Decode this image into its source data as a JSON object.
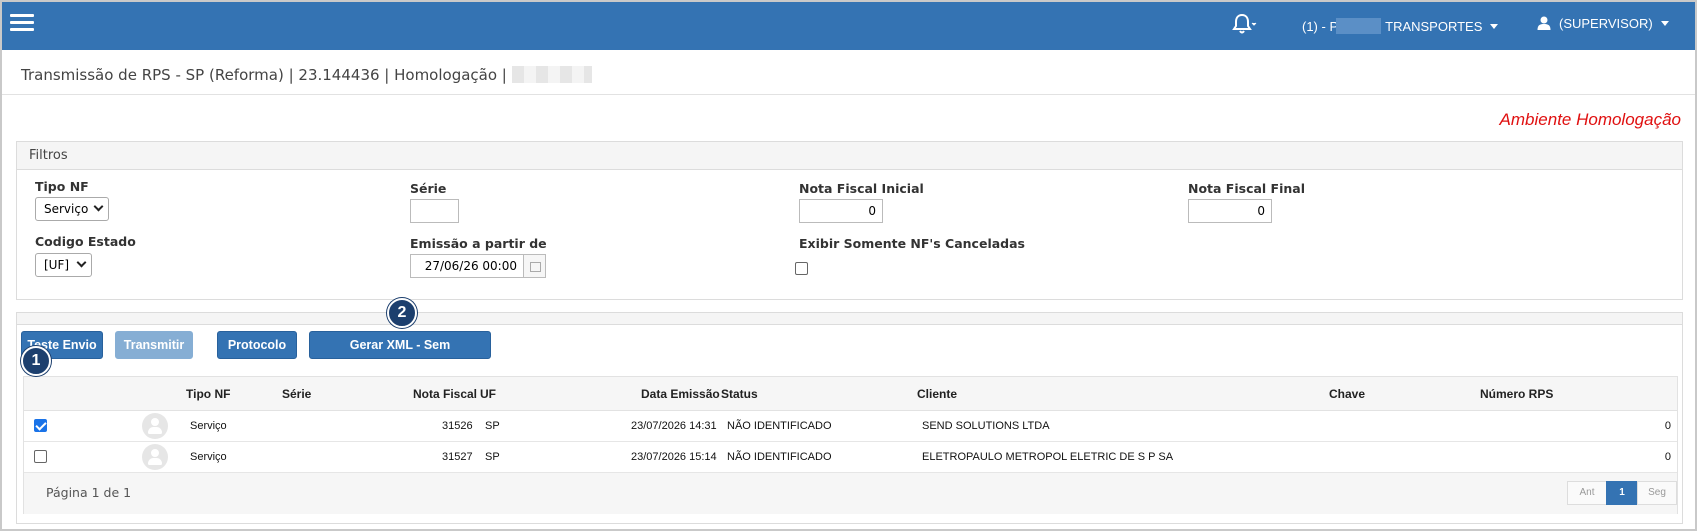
{
  "header": {
    "company": "(1) - P",
    "company_suffix": "TRANSPORTES",
    "user": "(SUPERVISOR)"
  },
  "page": {
    "title": "Transmissão de RPS - SP (Reforma) | 23.144436 | Homologação |",
    "ambiente": "Ambiente Homologação"
  },
  "filters": {
    "panel_title": "Filtros",
    "tipo_nf_label": "Tipo NF",
    "tipo_nf_value": "Serviço",
    "serie_label": "Série",
    "serie_value": "",
    "nf_inicial_label": "Nota Fiscal Inicial",
    "nf_inicial_value": "0",
    "nf_final_label": "Nota Fiscal Final",
    "nf_final_value": "0",
    "codigo_estado_label": "Codigo Estado",
    "codigo_estado_value": "[UF]",
    "emissao_label": "Emissão a partir de",
    "emissao_value": "27/06/26 00:00",
    "canceladas_label": "Exibir Somente NF's Canceladas",
    "canceladas_checked": false
  },
  "actions": {
    "teste_envio": "Teste Envio",
    "transmitir": "Transmitir",
    "protocolo": "Protocolo",
    "gerar_xml": "Gerar XML - Sem Transmissão",
    "badge_1": "1",
    "badge_2": "2"
  },
  "table": {
    "columns": {
      "tipo_nf": "Tipo NF",
      "serie": "Série",
      "nota_fiscal": "Nota Fiscal",
      "uf": "UF",
      "data_emissao": "Data Emissão",
      "status": "Status",
      "cliente": "Cliente",
      "chave": "Chave",
      "numero_rps": "Número RPS"
    },
    "rows": [
      {
        "checked": true,
        "tipo_nf": "Serviço",
        "serie": "",
        "nota_fiscal": "31526",
        "uf": "SP",
        "data_emissao": "23/07/2026 14:31",
        "status": "NÃO IDENTIFICADO",
        "cliente": "SEND SOLUTIONS LTDA",
        "chave": "",
        "numero_rps": "0"
      },
      {
        "checked": false,
        "tipo_nf": "Serviço",
        "serie": "",
        "nota_fiscal": "31527",
        "uf": "SP",
        "data_emissao": "23/07/2026 15:14",
        "status": "NÃO IDENTIFICADO",
        "cliente": "ELETROPAULO METROPOL ELETRIC DE S P SA",
        "chave": "",
        "numero_rps": "0"
      }
    ],
    "page_info": "Página 1 de 1",
    "pager": {
      "prev": "Ant",
      "current": "1",
      "next": "Seg"
    }
  },
  "colors": {
    "header_bg": "#3473b3",
    "ambiente": "#e01010",
    "badge": "#1c3f6e"
  }
}
